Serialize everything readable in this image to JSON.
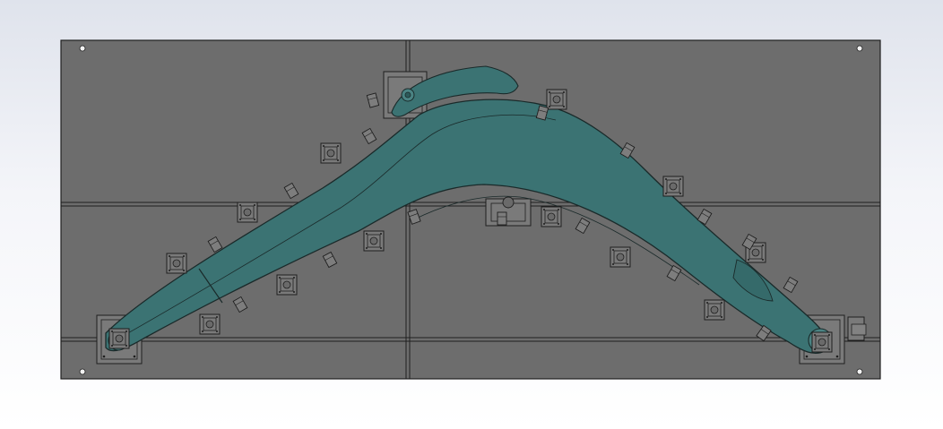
{
  "viewport": {
    "background": "gradient-white-to-pale-blue"
  },
  "fixture": {
    "base_plate_color": "#6d6d6d",
    "base_plate_line_color": "#1e1e1e",
    "boom_color": "#3b7373",
    "boom_outline_color": "#1a2a2a",
    "block_color": "#777777",
    "panels": 4,
    "locating_blocks": 14,
    "clamps": 16,
    "pivot_supports": 3,
    "corner_holes": 4
  }
}
